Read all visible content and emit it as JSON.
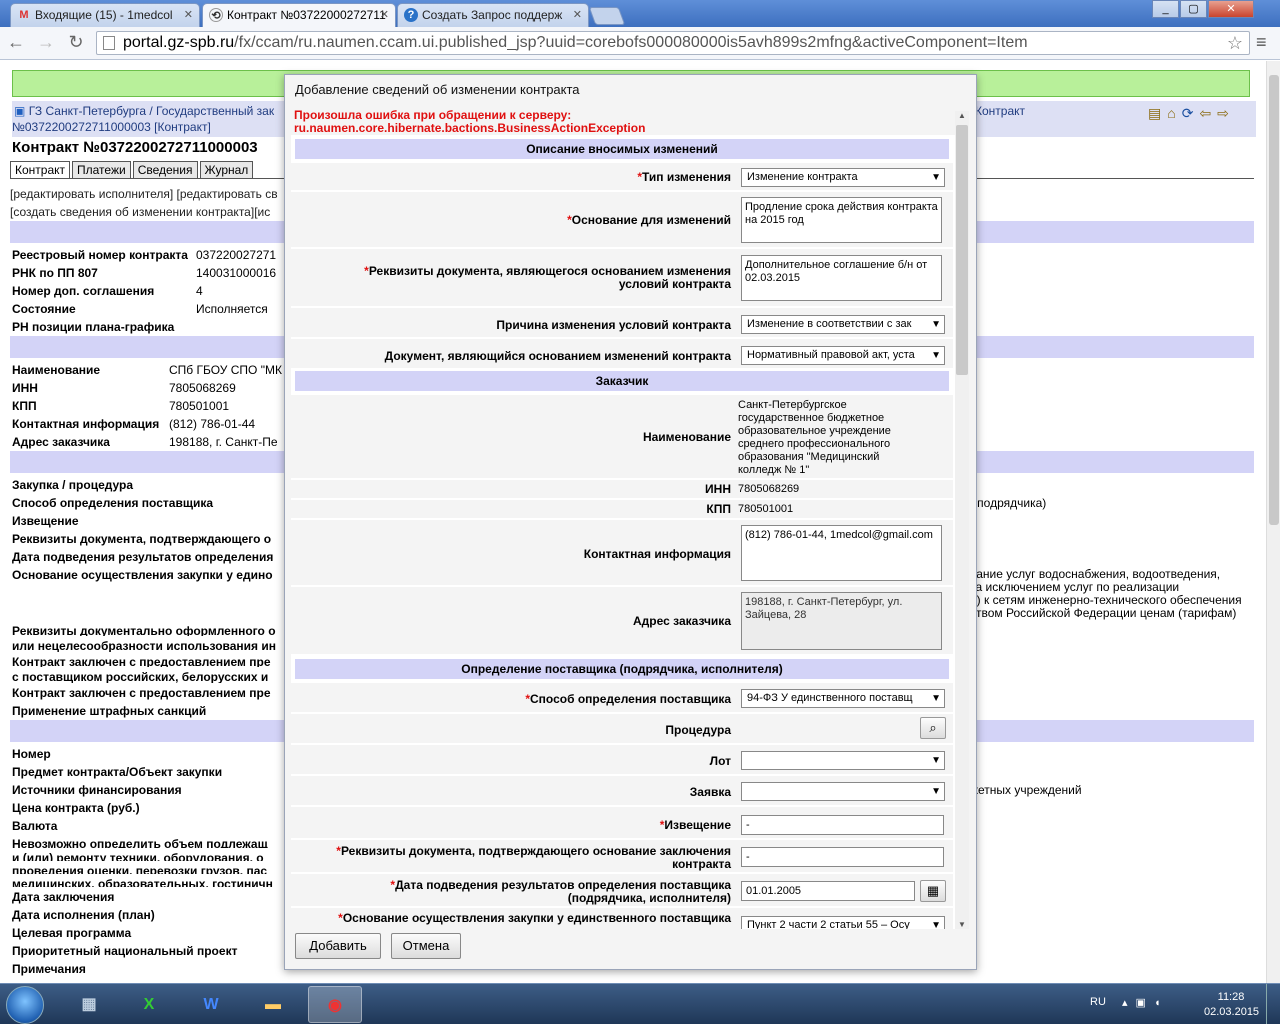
{
  "browser": {
    "tabs": [
      {
        "title": "Входящие (15) - 1medcol",
        "favicon": "gmail-icon",
        "active": false
      },
      {
        "title": "Контракт №03722000272711",
        "favicon": "gz-icon",
        "active": true
      },
      {
        "title": "Создать Запрос поддерж",
        "favicon": "help-icon",
        "active": false
      }
    ],
    "window_controls": [
      "_",
      "▢",
      "✕"
    ],
    "url_host": "portal.gz-spb.ru",
    "url_path": "/fx/ccam/ru.naumen.ccam.ui.published_jsp?uuid=corebofs000080000is5avh899s2mfng&activeComponent=Item"
  },
  "page": {
    "breadcrumb_line1": "ГЗ Санкт-Петербурга / Государственный зак",
    "breadcrumb_line1_right": "Контракт",
    "breadcrumb_line2": "№0372200272711000003 [Контракт]",
    "title": "Контракт №0372200272711000003",
    "tabs": [
      "Контракт",
      "Платежи",
      "Сведения",
      "Журнал"
    ],
    "links_line1": "[редактировать исполнителя] [редактировать св",
    "links_line2": "[создать сведения об изменении контракта][ис",
    "rows_a": [
      {
        "label": "Реестровый номер контракта",
        "value": "037220027271"
      },
      {
        "label": "РНК по ПП 807",
        "value": "140031000016"
      },
      {
        "label": "Номер доп. соглашения",
        "value": "4"
      },
      {
        "label": "Состояние",
        "value": "Исполняется"
      },
      {
        "label": "РН позиции плана-графика",
        "value": ""
      }
    ],
    "rows_b": [
      {
        "label": "Наименование",
        "value": "СПб ГБОУ СПО \"МК"
      },
      {
        "label": "ИНН",
        "value": "7805068269"
      },
      {
        "label": "КПП",
        "value": "780501001"
      },
      {
        "label": "Контактная информация",
        "value": "(812) 786-01-44"
      },
      {
        "label": "Адрес заказчика",
        "value": "198188, г. Санкт-Пе"
      }
    ],
    "rows_c": [
      {
        "label": "Закупка / процедура"
      },
      {
        "label": "Способ определения поставщика"
      },
      {
        "label": "Извещение"
      },
      {
        "label": "Реквизиты документа, подтверждающего о"
      },
      {
        "label": "Дата подведения результатов определения"
      },
      {
        "label": "Основание осуществления закупки у едино"
      },
      {
        "label": "Реквизиты документально оформленного о"
      },
      {
        "label": "или нецелесообразности использования ин"
      },
      {
        "label": "Контракт заключен с предоставлением пре"
      },
      {
        "label": "с поставщиком российских, белорусских и"
      },
      {
        "label": "Контракт заключен с предоставлением пре"
      },
      {
        "label": "Применение штрафных санкций"
      }
    ],
    "rows_d": [
      {
        "label": "Номер"
      },
      {
        "label": "Предмет контракта/Объект закупки"
      },
      {
        "label": "Источники финансирования"
      },
      {
        "label": "Цена контракта (руб.)"
      },
      {
        "label": "Валюта"
      },
      {
        "label": "Невозможно определить объем подлежащ"
      },
      {
        "label": "и (или) ремонту техники, оборудования, о"
      },
      {
        "label": "проведения оценки, перевозки грузов, пас"
      },
      {
        "label": "медицинских, образовательных, гостиничн"
      },
      {
        "label": "Дата заключения"
      },
      {
        "label": "Дата исполнения (план)"
      },
      {
        "label": "Целевая программа"
      },
      {
        "label": "Приоритетный национальный проект"
      },
      {
        "label": "Примечания"
      }
    ],
    "right_texts": {
      "podryadchika": "я, подрядчика)",
      "osnov1": "вание услуг водоснабжения, водоотведения,",
      "osnov2": "за исключением услуг по реализации",
      "osnov3": "е) к сетям инженерно-технического обеспечения",
      "osnov4": "ством Российской Федерации ценам (тарифам)",
      "istochniki": "жетных учреждений"
    }
  },
  "modal": {
    "title": "Добавление сведений об изменении контракта",
    "error_line1": "Произошла ошибка при обращении к серверу:",
    "error_line2": "ru.naumen.core.hibernate.bactions.BusinessActionException",
    "sections": {
      "changes": "Описание вносимых изменений",
      "customer": "Заказчик",
      "supplier": "Определение поставщика (подрядчика, исполнителя)"
    },
    "fields": {
      "change_type_label": "Тип изменения",
      "change_type_value": "Изменение контракта",
      "basis_label": "Основание для изменений",
      "basis_value": "Продление срока действия контракта на 2015 год",
      "doc_req_label_1": "Реквизиты документа, являющегося основанием изменения",
      "doc_req_label_2": "условий контракта",
      "doc_req_value": "Дополнительное соглашение б/н от 02.03.2015",
      "reason_label": "Причина изменения условий контракта",
      "reason_value": "Изменение в соответствии с зак",
      "basis_doc_label": "Документ, являющийся основанием изменений контракта",
      "basis_doc_value": "Нормативный правовой акт, уста",
      "cust_name_label": "Наименование",
      "cust_name_value": "Санкт-Петербургское государственное бюджетное образовательное учреждение среднего профессионального образования \"Медицинский колледж № 1\"",
      "inn_label": "ИНН",
      "inn_value": "7805068269",
      "kpp_label": "КПП",
      "kpp_value": "780501001",
      "contact_label": "Контактная информация",
      "contact_value": "(812) 786-01-44, 1medcol@gmail.com",
      "address_label": "Адрес заказчика",
      "address_value": "198188, г. Санкт-Петербург, ул. Зайцева, 28",
      "method_label": "Способ определения поставщика",
      "method_value": "94-ФЗ У единственного поставщ",
      "procedure_label": "Процедура",
      "lot_label": "Лот",
      "lot_value": "",
      "bid_label": "Заявка",
      "bid_value": "",
      "notice_label": "Извещение",
      "notice_value": "-",
      "confirm_label_1": "Реквизиты документа, подтверждающего основание заключения",
      "confirm_label_2": "контракта",
      "confirm_value": "-",
      "result_date_label_1": "Дата подведения результатов определения поставщика",
      "result_date_label_2": "(подрядчика, исполнителя)",
      "result_date_value": "01.01.2005",
      "sole_label": "Основание осуществления закупки у единственного поставщика",
      "sole_value": "Пункт 2 части 2 статьи 55 – Осу"
    },
    "buttons": {
      "add": "Добавить",
      "cancel": "Отмена"
    }
  },
  "taskbar": {
    "lang": "RU",
    "time": "11:28",
    "date": "02.03.2015",
    "apps": [
      "calculator-icon",
      "excel-icon",
      "word-icon",
      "folder-icon",
      "chrome-icon"
    ]
  },
  "colors": {
    "section_bg": "#d3d3f7",
    "error": "#e01010",
    "greenbar": "#b8f09a",
    "taskbar": "#2a4569"
  }
}
